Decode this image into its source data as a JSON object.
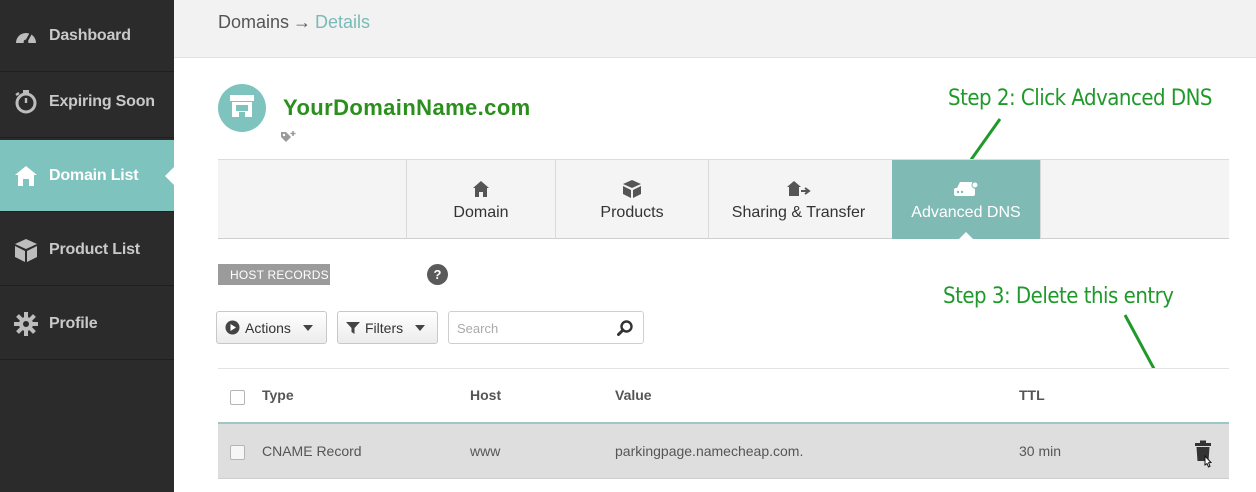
{
  "sidebar": {
    "items": [
      {
        "label": "Dashboard",
        "icon": "gauge-icon",
        "active": false
      },
      {
        "label": "Expiring Soon",
        "icon": "stopwatch-icon",
        "active": false
      },
      {
        "label": "Domain List",
        "icon": "home-icon",
        "active": true
      },
      {
        "label": "Product List",
        "icon": "box-icon",
        "active": false
      },
      {
        "label": "Profile",
        "icon": "gear-icon",
        "active": false
      }
    ]
  },
  "header": {
    "breadcrumb_root": "Domains",
    "breadcrumb_sep": "→",
    "breadcrumb_current": "Details"
  },
  "domain": {
    "name": "YourDomainName.com",
    "avatar_icon": "storefront-icon",
    "tag_icon": "add-tag-icon"
  },
  "annotations": {
    "step2": "Step 2: Click Advanced DNS",
    "step3": "Step 3: Delete this entry"
  },
  "tabs": [
    {
      "label": "Domain",
      "icon": "home-icon",
      "active": false
    },
    {
      "label": "Products",
      "icon": "box-icon",
      "active": false
    },
    {
      "label": "Sharing & Transfer",
      "icon": "share-icon",
      "active": false
    },
    {
      "label": "Advanced DNS",
      "icon": "server-icon",
      "active": true
    }
  ],
  "host_records": {
    "section_label": "HOST RECORDS",
    "help_glyph": "?",
    "actions_label": "Actions",
    "filters_label": "Filters",
    "search_placeholder": "Search",
    "columns": [
      "Type",
      "Host",
      "Value",
      "TTL"
    ],
    "rows": [
      {
        "type": "CNAME Record",
        "host": "www",
        "value": "parkingpage.namecheap.com.",
        "ttl": "30 min"
      }
    ]
  },
  "colors": {
    "sidebar_bg": "#2b2b2b",
    "accent": "#7fc3bf",
    "annotation": "#1f9a2a",
    "domain_name": "#2a8f1c"
  }
}
